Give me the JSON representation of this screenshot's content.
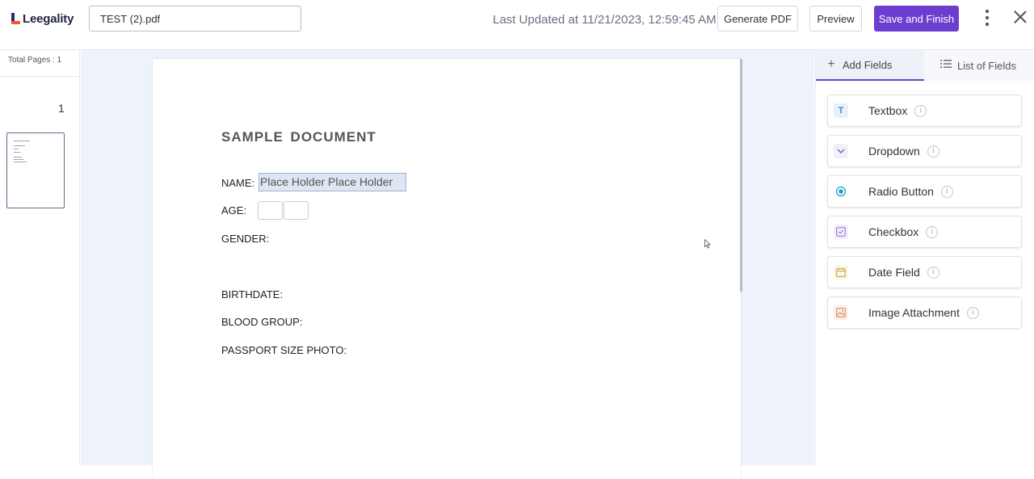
{
  "header": {
    "logo_text": "Leegality",
    "filename": "TEST (2).pdf",
    "last_updated": "Last Updated at 11/21/2023, 12:59:45 AM",
    "generate_pdf": "Generate PDF",
    "preview": "Preview",
    "save_finish": "Save and Finish",
    "accent_color": "#6a3fd0"
  },
  "sidebar": {
    "total_pages": "Total Pages : 1",
    "page_number": "1"
  },
  "document": {
    "title": "SAMPLE  DOCUMENT",
    "name_label": "NAME:",
    "name_placeholder": "Place Holder Place Holder",
    "age_label": "AGE:",
    "gender_label": "GENDER:",
    "birthdate_label": "BIRTHDATE:",
    "blood_group_label": "BLOOD GROUP:",
    "photo_label": "PASSPORT SIZE PHOTO:"
  },
  "panel": {
    "tabs": [
      {
        "label": "Add Fields",
        "icon": "plus-icon"
      },
      {
        "label": "List of Fields",
        "icon": "list-icon"
      }
    ],
    "fields": [
      {
        "label": "Textbox",
        "icon": "textbox-icon"
      },
      {
        "label": "Dropdown",
        "icon": "dropdown-icon"
      },
      {
        "label": "Radio Button",
        "icon": "radio-icon"
      },
      {
        "label": "Checkbox",
        "icon": "checkbox-icon"
      },
      {
        "label": "Date Field",
        "icon": "calendar-icon"
      },
      {
        "label": "Image Attachment",
        "icon": "image-icon"
      }
    ]
  }
}
